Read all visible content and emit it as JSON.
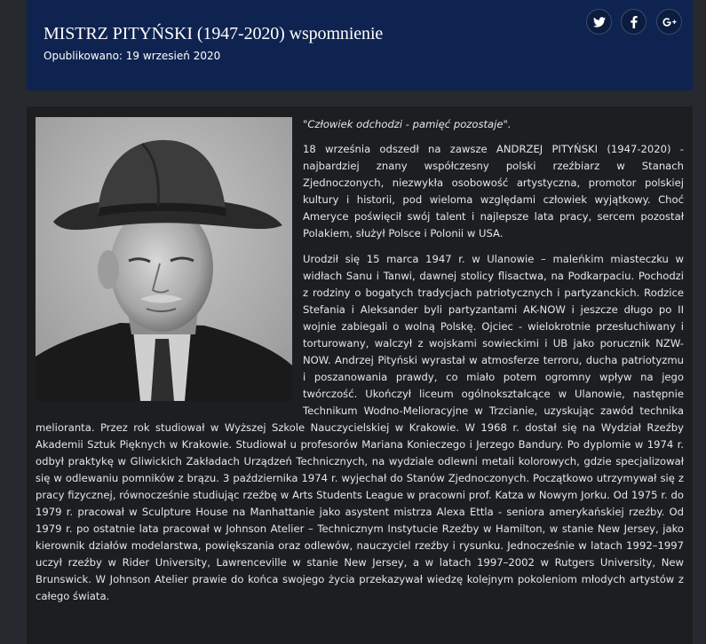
{
  "header": {
    "title": "MISTRZ PITYŃSKI (1947-2020) wspomnienie",
    "published": "Opublikowano: 19 wrzesień 2020"
  },
  "social": [
    {
      "name": "twitter",
      "icon": "twitter-icon"
    },
    {
      "name": "facebook",
      "icon": "facebook-icon"
    },
    {
      "name": "google-plus",
      "icon": "google-plus-icon"
    }
  ],
  "article": {
    "quote": "\"Człowiek odchodzi - pamięć pozostaje\".",
    "paragraph1": "18 września odszedł na zawsze ANDRZEJ PITYŃSKI (1947-2020) - najbardziej znany współczesny polski rzeźbiarz w Stanach Zjednoczonych, niezwykła osobowość artystyczna, promotor polskiej kultury i historii, pod wieloma względami człowiek wyjątkowy. Choć Ameryce poświęcił swój talent i najlepsze lata pracy, sercem pozostał Polakiem, służył Polsce i Polonii w USA.",
    "paragraph2": "Urodził się 15 marca 1947 r. w Ulanowie – maleńkim miasteczku w widłach Sanu i Tanwi, dawnej stolicy flisactwa, na Podkarpaciu. Pochodzi z rodziny o bogatych tradycjach patriotycznych i partyzanckich. Rodzice Stefania i Aleksander byli partyzantami AK-NOW i jeszcze długo po II wojnie zabiegali o wolną Polskę. Ojciec - wielokrotnie przesłuchiwany i torturowany, walczył z wojskami sowieckimi i UB jako porucznik NZW-NOW. Andrzej Pityński wyrastał w atmosferze terroru, ducha patriotyzmu i poszanowania prawdy, co miało potem ogromny wpływ na jego twórczość. Ukończył liceum ogólnokształcące w Ulanowie, następnie Technikum Wodno-Melioracyjne w Trzcianie, uzyskując zawód technika melioranta. Przez rok studiował w Wyższej Szkole Nauczycielskiej w Krakowie. W 1968 r. dostał się na Wydział Rzeźby Akademii Sztuk Pięknych w Krakowie. Studiował u profesorów Mariana Konieczego i Jerzego Bandury. Po dyplomie w 1974 r. odbył praktykę w Gliwickich Zakładach Urządzeń Technicznych, na wydziale odlewni metali kolorowych, gdzie specjalizował się w odlewaniu pomników z brązu. 3 października 1974 r. wyjechał do Stanów Zjednoczonych. Początkowo utrzymywał się z pracy fizycznej, równocześnie studiując rzeźbę w Arts Students League w pracowni prof. Katza w Nowym Jorku. Od 1975 r. do 1979 r. pracował w Sculpture House na Manhattanie jako asystent mistrza Alexa Ettla - seniora amerykańskiej rzeźby. Od 1979 r. po ostatnie lata pracował w Johnson Atelier – Technicznym Instytucie Rzeźby w Hamilton, w stanie New Jersey, jako kierownik działów modelarstwa, powiększania oraz odlewów, nauczyciel rzeźby i rysunku. Jednocześnie w latach 1992–1997 uczył rzeźby w Rider University, Lawrenceville w stanie New Jersey, a w latach 1997–2002 w Rutgers University, New Brunswick. W Johnson Atelier prawie do końca swojego życia przekazywał wiedzę kolejnym pokoleniom młodych artystów z całego świata."
  },
  "colors": {
    "page_background": "#262a2e",
    "header_background": "#0f2350",
    "content_background": "#1c1e20",
    "text": "#e6e6e6"
  }
}
